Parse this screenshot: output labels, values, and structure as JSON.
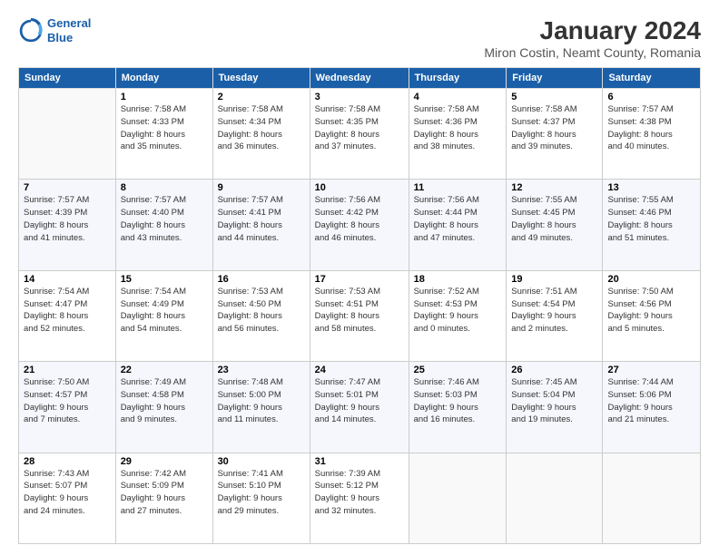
{
  "header": {
    "logo_line1": "General",
    "logo_line2": "Blue",
    "title": "January 2024",
    "subtitle": "Miron Costin, Neamt County, Romania"
  },
  "days_of_week": [
    "Sunday",
    "Monday",
    "Tuesday",
    "Wednesday",
    "Thursday",
    "Friday",
    "Saturday"
  ],
  "weeks": [
    [
      {
        "day": "",
        "info": ""
      },
      {
        "day": "1",
        "info": "Sunrise: 7:58 AM\nSunset: 4:33 PM\nDaylight: 8 hours\nand 35 minutes."
      },
      {
        "day": "2",
        "info": "Sunrise: 7:58 AM\nSunset: 4:34 PM\nDaylight: 8 hours\nand 36 minutes."
      },
      {
        "day": "3",
        "info": "Sunrise: 7:58 AM\nSunset: 4:35 PM\nDaylight: 8 hours\nand 37 minutes."
      },
      {
        "day": "4",
        "info": "Sunrise: 7:58 AM\nSunset: 4:36 PM\nDaylight: 8 hours\nand 38 minutes."
      },
      {
        "day": "5",
        "info": "Sunrise: 7:58 AM\nSunset: 4:37 PM\nDaylight: 8 hours\nand 39 minutes."
      },
      {
        "day": "6",
        "info": "Sunrise: 7:57 AM\nSunset: 4:38 PM\nDaylight: 8 hours\nand 40 minutes."
      }
    ],
    [
      {
        "day": "7",
        "info": "Sunrise: 7:57 AM\nSunset: 4:39 PM\nDaylight: 8 hours\nand 41 minutes."
      },
      {
        "day": "8",
        "info": "Sunrise: 7:57 AM\nSunset: 4:40 PM\nDaylight: 8 hours\nand 43 minutes."
      },
      {
        "day": "9",
        "info": "Sunrise: 7:57 AM\nSunset: 4:41 PM\nDaylight: 8 hours\nand 44 minutes."
      },
      {
        "day": "10",
        "info": "Sunrise: 7:56 AM\nSunset: 4:42 PM\nDaylight: 8 hours\nand 46 minutes."
      },
      {
        "day": "11",
        "info": "Sunrise: 7:56 AM\nSunset: 4:44 PM\nDaylight: 8 hours\nand 47 minutes."
      },
      {
        "day": "12",
        "info": "Sunrise: 7:55 AM\nSunset: 4:45 PM\nDaylight: 8 hours\nand 49 minutes."
      },
      {
        "day": "13",
        "info": "Sunrise: 7:55 AM\nSunset: 4:46 PM\nDaylight: 8 hours\nand 51 minutes."
      }
    ],
    [
      {
        "day": "14",
        "info": "Sunrise: 7:54 AM\nSunset: 4:47 PM\nDaylight: 8 hours\nand 52 minutes."
      },
      {
        "day": "15",
        "info": "Sunrise: 7:54 AM\nSunset: 4:49 PM\nDaylight: 8 hours\nand 54 minutes."
      },
      {
        "day": "16",
        "info": "Sunrise: 7:53 AM\nSunset: 4:50 PM\nDaylight: 8 hours\nand 56 minutes."
      },
      {
        "day": "17",
        "info": "Sunrise: 7:53 AM\nSunset: 4:51 PM\nDaylight: 8 hours\nand 58 minutes."
      },
      {
        "day": "18",
        "info": "Sunrise: 7:52 AM\nSunset: 4:53 PM\nDaylight: 9 hours\nand 0 minutes."
      },
      {
        "day": "19",
        "info": "Sunrise: 7:51 AM\nSunset: 4:54 PM\nDaylight: 9 hours\nand 2 minutes."
      },
      {
        "day": "20",
        "info": "Sunrise: 7:50 AM\nSunset: 4:56 PM\nDaylight: 9 hours\nand 5 minutes."
      }
    ],
    [
      {
        "day": "21",
        "info": "Sunrise: 7:50 AM\nSunset: 4:57 PM\nDaylight: 9 hours\nand 7 minutes."
      },
      {
        "day": "22",
        "info": "Sunrise: 7:49 AM\nSunset: 4:58 PM\nDaylight: 9 hours\nand 9 minutes."
      },
      {
        "day": "23",
        "info": "Sunrise: 7:48 AM\nSunset: 5:00 PM\nDaylight: 9 hours\nand 11 minutes."
      },
      {
        "day": "24",
        "info": "Sunrise: 7:47 AM\nSunset: 5:01 PM\nDaylight: 9 hours\nand 14 minutes."
      },
      {
        "day": "25",
        "info": "Sunrise: 7:46 AM\nSunset: 5:03 PM\nDaylight: 9 hours\nand 16 minutes."
      },
      {
        "day": "26",
        "info": "Sunrise: 7:45 AM\nSunset: 5:04 PM\nDaylight: 9 hours\nand 19 minutes."
      },
      {
        "day": "27",
        "info": "Sunrise: 7:44 AM\nSunset: 5:06 PM\nDaylight: 9 hours\nand 21 minutes."
      }
    ],
    [
      {
        "day": "28",
        "info": "Sunrise: 7:43 AM\nSunset: 5:07 PM\nDaylight: 9 hours\nand 24 minutes."
      },
      {
        "day": "29",
        "info": "Sunrise: 7:42 AM\nSunset: 5:09 PM\nDaylight: 9 hours\nand 27 minutes."
      },
      {
        "day": "30",
        "info": "Sunrise: 7:41 AM\nSunset: 5:10 PM\nDaylight: 9 hours\nand 29 minutes."
      },
      {
        "day": "31",
        "info": "Sunrise: 7:39 AM\nSunset: 5:12 PM\nDaylight: 9 hours\nand 32 minutes."
      },
      {
        "day": "",
        "info": ""
      },
      {
        "day": "",
        "info": ""
      },
      {
        "day": "",
        "info": ""
      }
    ]
  ]
}
